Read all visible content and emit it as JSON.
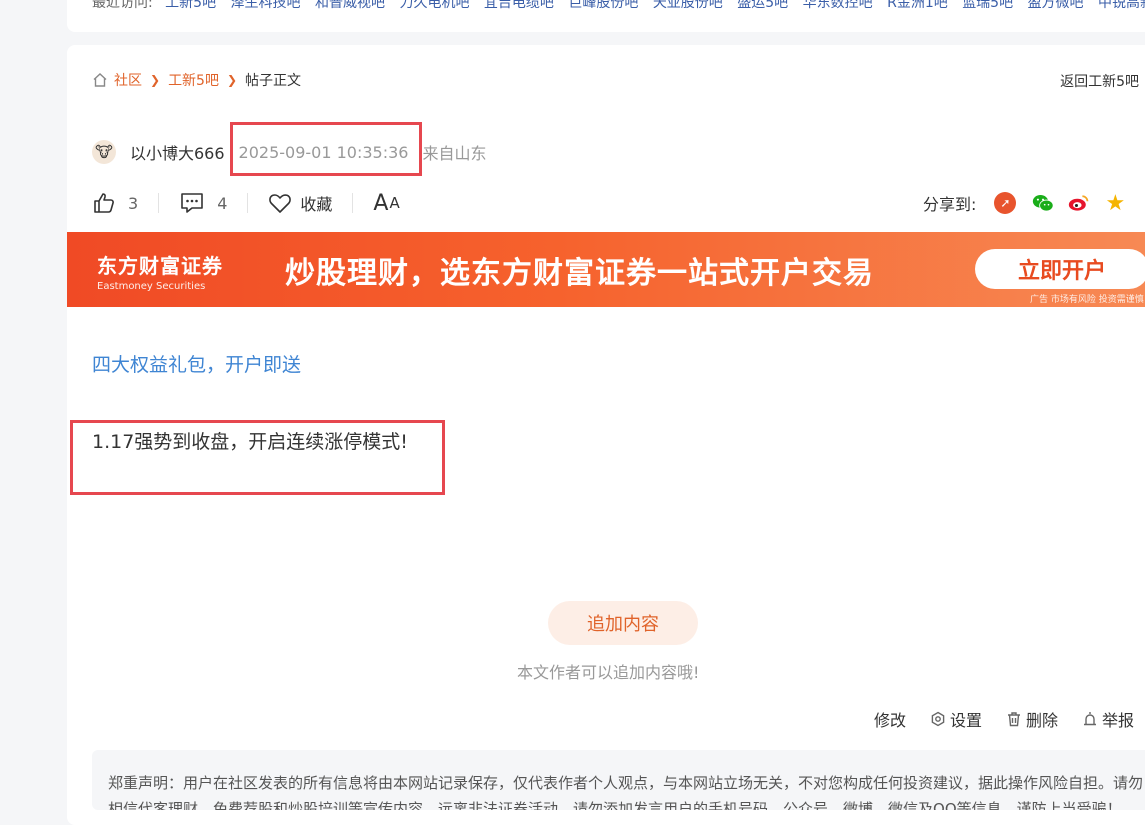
{
  "recent": {
    "label": "最近访问:",
    "items": [
      "工新5吧",
      "泽生科技吧",
      "和普威视吧",
      "力久电机吧",
      "宜吉电缆吧",
      "巨峰股份吧",
      "天亚股份吧",
      "盛运5吧",
      "华东数控吧",
      "R金洲1吧",
      "蓝瑞5吧",
      "盈方微吧",
      "中锐高新吧"
    ]
  },
  "breadcrumb": {
    "community": "社区",
    "bar": "工新5吧",
    "current": "帖子正文",
    "back": "返回工新5吧"
  },
  "post": {
    "author": "以小博大666",
    "time": "2025-09-01 10:35:36",
    "from": "来自山东",
    "likes": "3",
    "comments": "4",
    "favorite": "收藏",
    "font_toggle_big": "A",
    "font_toggle_small": "A",
    "share_label": "分享到:",
    "promo_link": "四大权益礼包，开户即送",
    "content": "1.17强势到收盘，开启连续涨停模式!",
    "append_button": "追加内容",
    "append_hint": "本文作者可以追加内容哦!"
  },
  "banner": {
    "logo_cn": "东方财富证券",
    "logo_en": "Eastmoney Securities",
    "title": "炒股理财，选东方财富证券一站式开户交易",
    "button": "立即开户",
    "ad_note": "广告 市场有风险 投资需谨慎"
  },
  "ops": {
    "edit": "修改",
    "settings": "设置",
    "delete": "删除",
    "report": "举报"
  },
  "disclaimer": "郑重声明：用户在社区发表的所有信息将由本网站记录保存，仅代表作者个人观点，与本网站立场无关，不对您构成任何投资建议，据此操作风险自担。请勿相信代客理财、免费荐股和炒股培训等宣传内容，远离非法证券活动。请勿添加发言用户的手机号码、公众号、微博、微信及QQ等信息，谨防上当受骗！",
  "colors": {
    "accent": "#e0632a",
    "link": "#3f85d3",
    "highlight": "#e6474f"
  }
}
